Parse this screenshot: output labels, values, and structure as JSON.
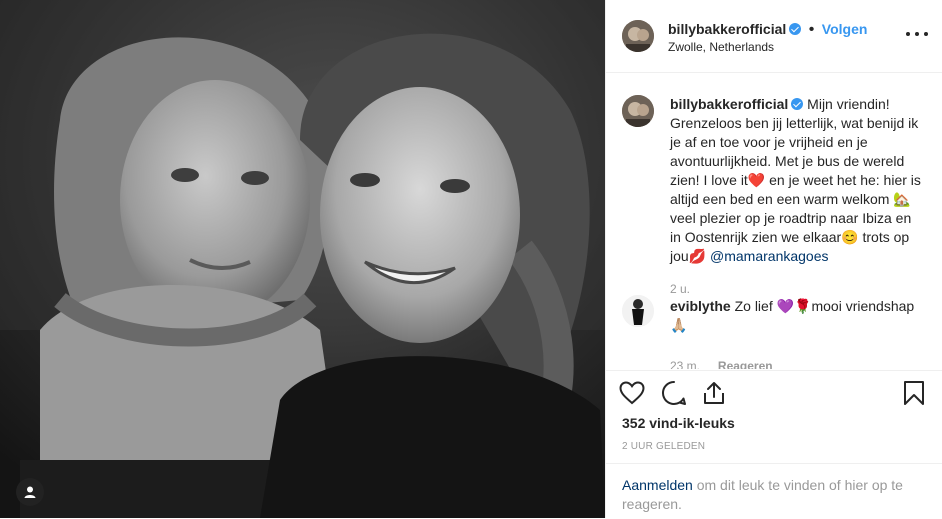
{
  "post": {
    "username": "billybakkerofficial",
    "separator": "•",
    "follow_label": "Volgen",
    "location": "Zwolle, Netherlands",
    "caption_text": "Mijn vriendin! Grenzeloos ben jij letterlijk, wat benijd ik je af en toe voor je vrijheid en je avontuurlijkheid. Met je bus de wereld zien! I love it❤️ en je weet het he: hier is altijd een bed en een warm welkom 🏡 veel plezier op je roadtrip naar Ibiza en in Oostenrijk zien we elkaar😊 trots op jou💋",
    "caption_mention": "@mamarankagoes",
    "caption_time": "2 u.",
    "likes": "352 vind-ik-leuks",
    "time_ago": "2 UUR GELEDEN"
  },
  "comments": [
    {
      "username": "eviblythe",
      "text": "Zo lief 💜🌹mooi vriendshap 🙏🏼",
      "time": "23 m.",
      "reply_label": "Reageren"
    }
  ],
  "footer": {
    "login_link": "Aanmelden",
    "login_text": "om dit leuk te vinden of hier op te reageren."
  },
  "icons": {
    "like": "heart-icon",
    "comment": "comment-icon",
    "share": "share-icon",
    "save": "bookmark-icon",
    "more": "more-options-icon",
    "tags": "user-tag-icon"
  },
  "colors": {
    "accent": "#3897f0",
    "link": "#003569",
    "muted": "#999999",
    "text": "#262626",
    "border": "#efefef"
  }
}
